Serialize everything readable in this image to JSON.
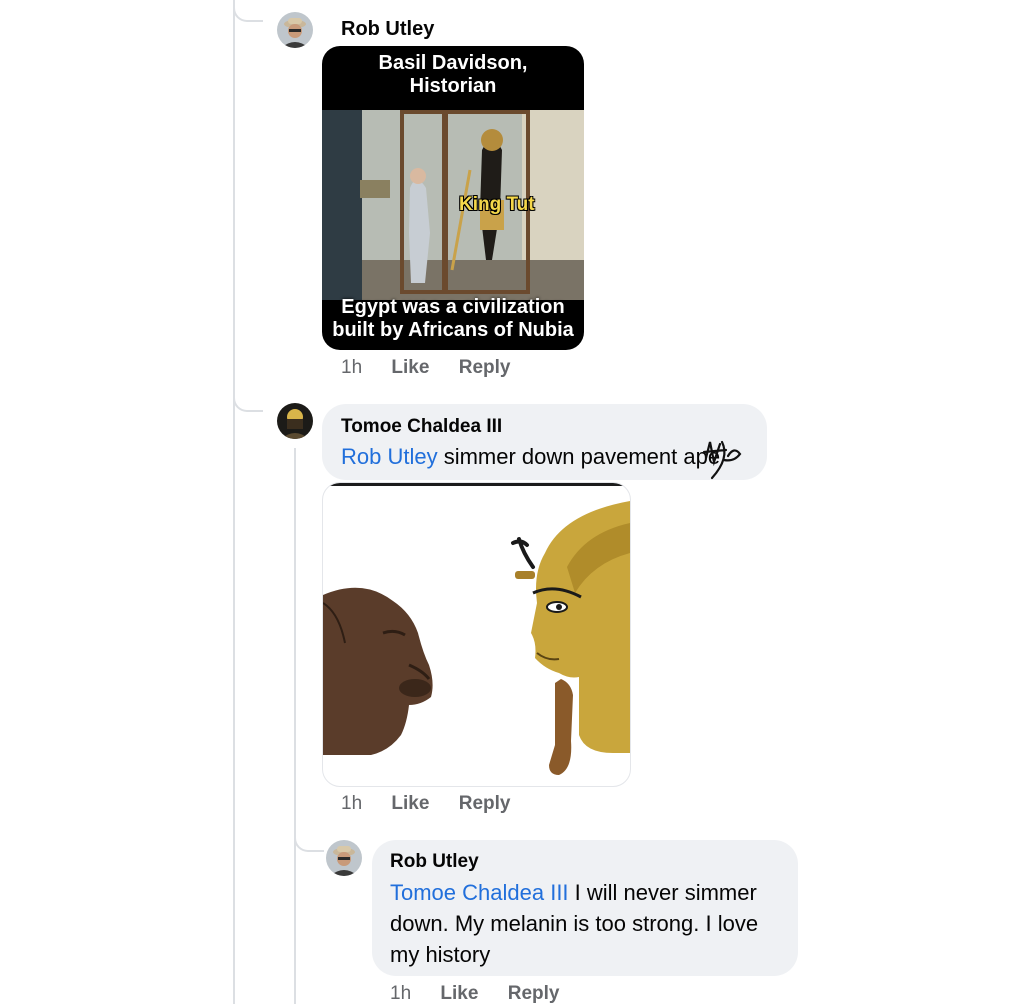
{
  "comments": [
    {
      "author": "Rob Utley",
      "image": {
        "header_line1": "Basil Davidson,",
        "header_line2": "Historian",
        "overlay_label": "King Tut",
        "caption_line1": "Egypt was a civilization",
        "caption_line2": "built by Africans of Nubia"
      },
      "time": "1h",
      "like": "Like",
      "reply": "Reply"
    },
    {
      "author": "Tomoe Chaldea III",
      "mention": "Rob Utley",
      "text": "simmer down pavement ape",
      "time": "1h",
      "like": "Like",
      "reply": "Reply"
    },
    {
      "author": "Rob Utley",
      "mention": "Tomoe Chaldea III",
      "text_line1": " I will never simmer",
      "text_line2": "down. My melanin is too strong. I love",
      "text_line3": "my history",
      "time": "1h",
      "like": "Like",
      "reply": "Reply"
    }
  ],
  "colors": {
    "mention": "#216fdb",
    "bubble": "#eff1f4",
    "meta": "#65676b"
  }
}
